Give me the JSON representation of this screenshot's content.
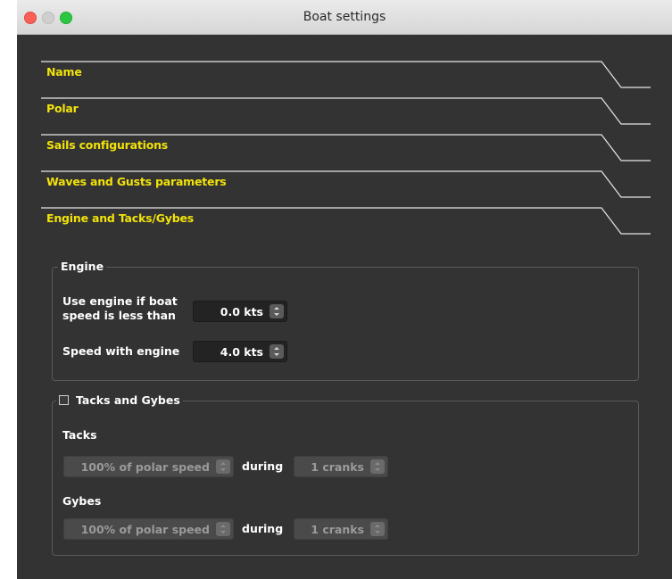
{
  "window": {
    "title": "Boat settings"
  },
  "sections": [
    {
      "label": "Name"
    },
    {
      "label": "Polar"
    },
    {
      "label": "Sails configurations"
    },
    {
      "label": "Waves and Gusts parameters"
    },
    {
      "label": "Engine and Tacks/Gybes"
    }
  ],
  "engine": {
    "legend": "Engine",
    "use_engine_label_line1": "Use engine if boat",
    "use_engine_label_line2": "speed is less than",
    "use_engine_value": "0.0 kts",
    "speed_label": "Speed with engine",
    "speed_value": "4.0 kts"
  },
  "tacks_gybes": {
    "legend": "Tacks and Gybes",
    "checked": false,
    "tacks_label": "Tacks",
    "tacks_polar": "100% of polar speed",
    "tacks_during": "during",
    "tacks_cranks": "1 cranks",
    "gybes_label": "Gybes",
    "gybes_polar": "100% of polar speed",
    "gybes_during": "during",
    "gybes_cranks": "1 cranks"
  }
}
